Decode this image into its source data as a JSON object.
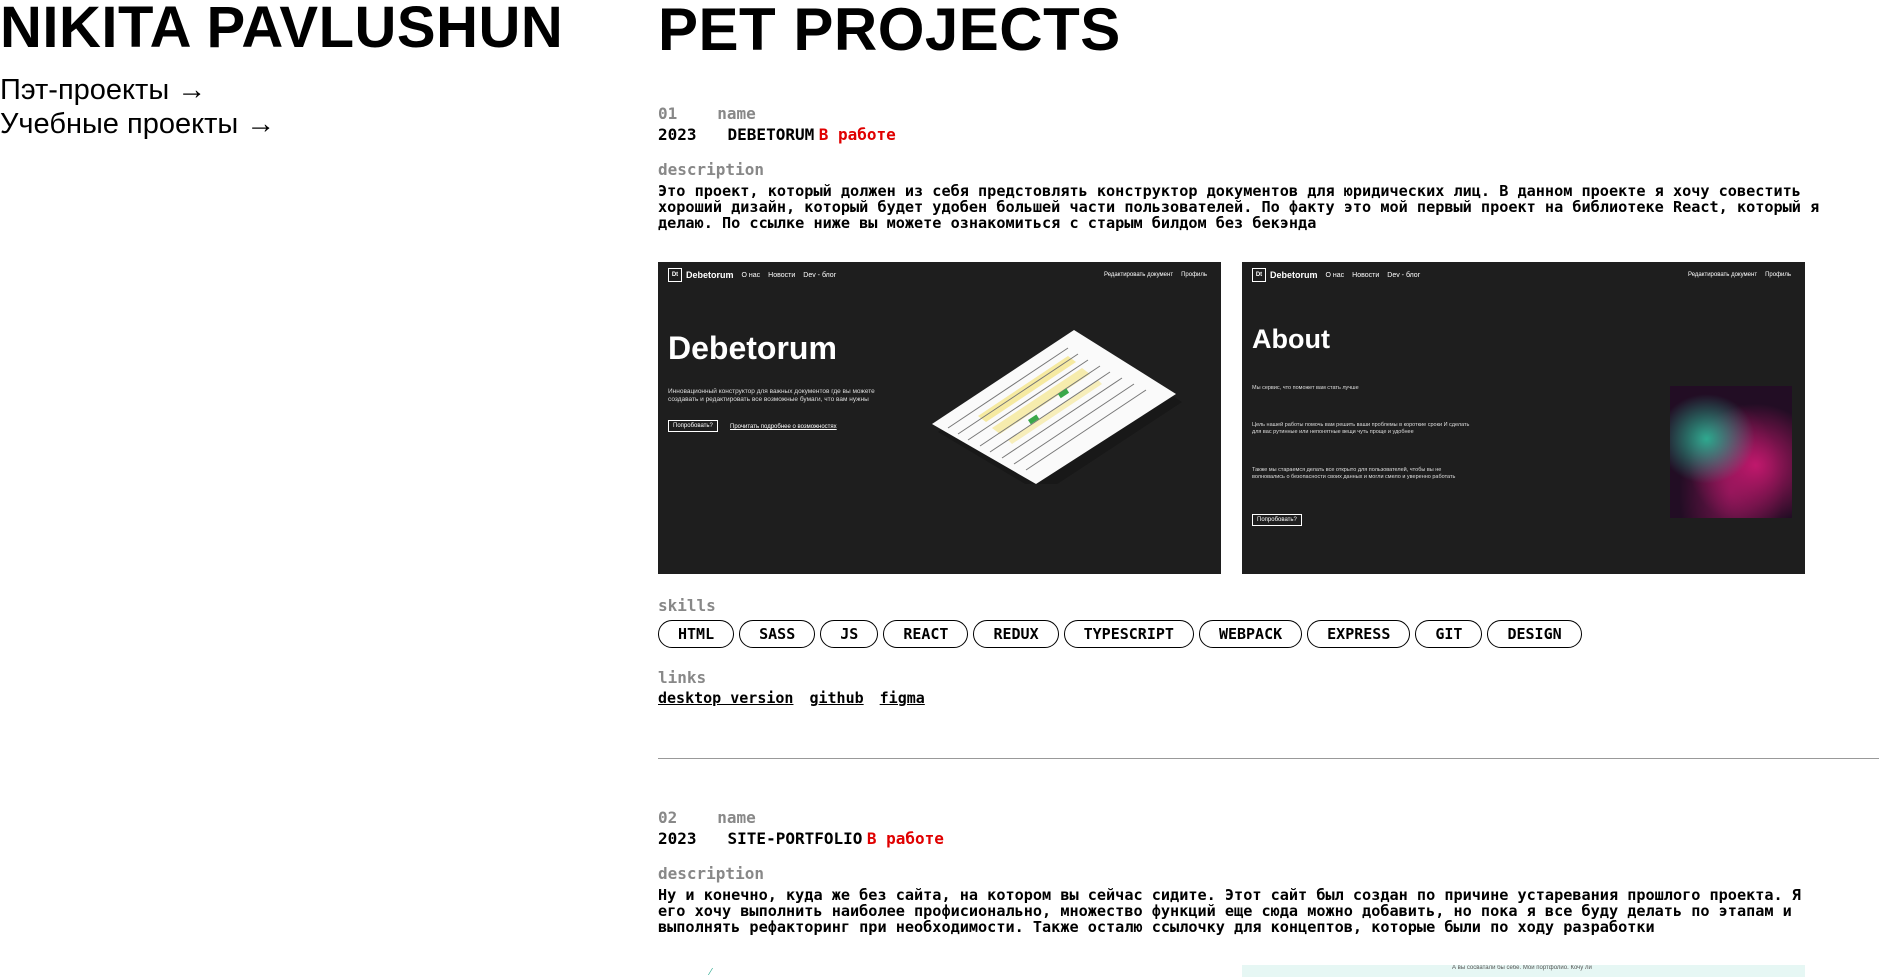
{
  "owner": "NIKITA PAVLUSHUN",
  "nav": [
    {
      "label": "Пэт-проекты →"
    },
    {
      "label": "Учебные проекты →"
    }
  ],
  "page_title": "PET PROJECTS",
  "projects": [
    {
      "number": "01",
      "name_label": "name",
      "year": "2023",
      "name": "DEBETORUM",
      "status": "В работе",
      "description_label": "description",
      "description": "Это проект, который должен из себя предстовлять конструктор документов для юридических лиц. В данном проекте я хочу совестить\nхороший дизайн, который будет удобен большей части пользователей. По факту это мой первый проект на библиотеке React, который я\nделаю. По ссылке ниже вы можете ознакомиться с старым билдом без бекэнда",
      "screens": [
        {
          "logo": "Debetorum",
          "menu": [
            "О нас",
            "Новости",
            "Dev - блог"
          ],
          "menu_right": [
            "Редактировать документ",
            "Профиль"
          ],
          "heading": "Debetorum",
          "text": "Инновационный конструктор для важных документов где вы можете создавать и редактировать все возможные бумаги, что вам нужны",
          "button": "Попробовать?",
          "link": "Прочитать подробнее о возможностях"
        },
        {
          "logo": "Debetorum",
          "menu": [
            "О нас",
            "Новости",
            "Dev - блог"
          ],
          "menu_right": [
            "Редактировать документ",
            "Профиль"
          ],
          "heading": "About",
          "text1": "Мы сервис, что поможет вам стать лучше",
          "text2": "Цель нашей работы помочь вам решить ваши проблемы в короткие сроки И сделать для вас рутинные или непонятные вещи чуть проще и удобнее",
          "text3": "Также мы стараемся делать все открыто для пользователей, чтобы вы не волновались о безопасности своих данных и могли смело и уверенно работать",
          "button": "Попробовать?"
        }
      ],
      "skills_label": "skills",
      "skills": [
        "HTML",
        "SASS",
        "JS",
        "REACT",
        "REDUX",
        "TYPESCRIPT",
        "WEBPACK",
        "EXPRESS",
        "GIT",
        "DESIGN"
      ],
      "links_label": "links",
      "links": [
        "desktop version",
        "github",
        "figma"
      ]
    },
    {
      "number": "02",
      "name_label": "name",
      "year": "2023",
      "name": "SITE-PORTFOLIO",
      "status": "В работе",
      "description_label": "description",
      "description": "Ну и конечно, куда же без сайта, на котором вы сейчас сидите. Этот сайт был создан по причине устаревания прошлого проекта. Я\nего хочу выполнить наиболее профисионально, множество функций еще сюда можно добавить, но пока я все буду делать по этапам и\nвыполнять рефакторинг при необходимости. Также осталю ссылочку для концептов, которые были по ходу разработки",
      "screen_caption": "А вы сосватали бы себе. Мой портфолио. Кочу ли"
    }
  ],
  "colors": {
    "status": "#e00000",
    "label": "#888888",
    "screen_bg": "#1e1e1e",
    "divider": "#999999"
  }
}
